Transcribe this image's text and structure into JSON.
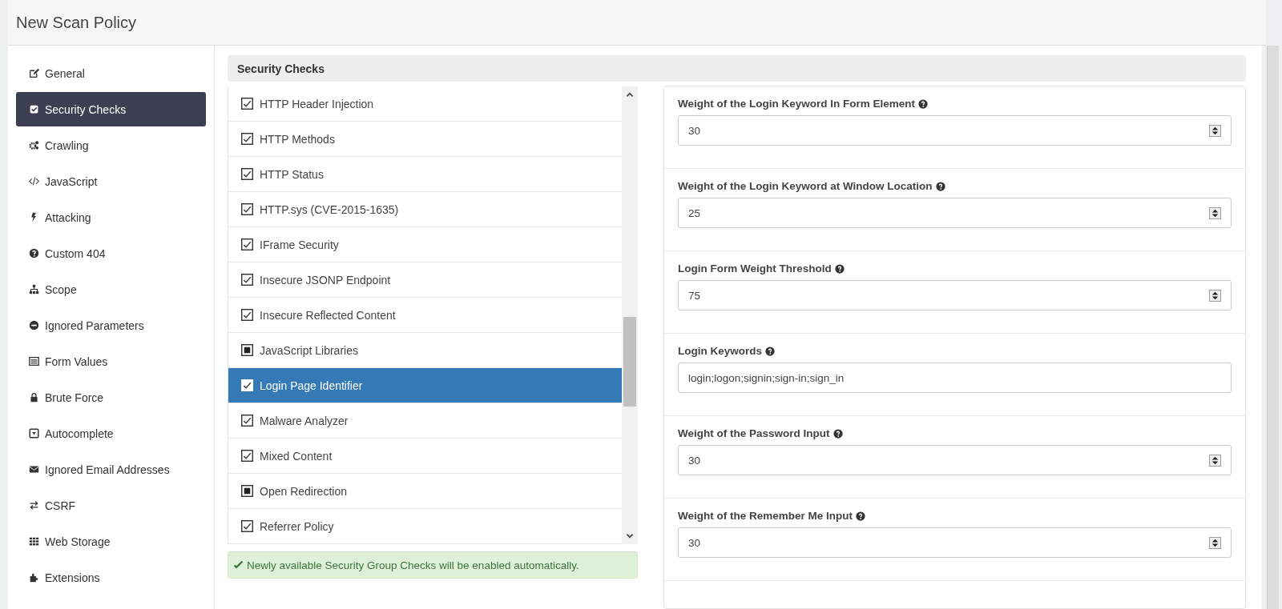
{
  "window": {
    "title": "New Scan Policy"
  },
  "sidebar": {
    "items": [
      {
        "label": "General",
        "selected": false
      },
      {
        "label": "Security Checks",
        "selected": true
      },
      {
        "label": "Crawling",
        "selected": false
      },
      {
        "label": "JavaScript",
        "selected": false
      },
      {
        "label": "Attacking",
        "selected": false
      },
      {
        "label": "Custom 404",
        "selected": false
      },
      {
        "label": "Scope",
        "selected": false
      },
      {
        "label": "Ignored Parameters",
        "selected": false
      },
      {
        "label": "Form Values",
        "selected": false
      },
      {
        "label": "Brute Force",
        "selected": false
      },
      {
        "label": "Autocomplete",
        "selected": false
      },
      {
        "label": "Ignored Email Addresses",
        "selected": false
      },
      {
        "label": "CSRF",
        "selected": false
      },
      {
        "label": "Web Storage",
        "selected": false
      },
      {
        "label": "Extensions",
        "selected": false
      }
    ]
  },
  "panel": {
    "title": "Security Checks"
  },
  "checks": [
    {
      "label": "HTTP Header Injection",
      "checked": true,
      "indeterminate": false,
      "selected": false
    },
    {
      "label": "HTTP Methods",
      "checked": true,
      "indeterminate": false,
      "selected": false
    },
    {
      "label": "HTTP Status",
      "checked": true,
      "indeterminate": false,
      "selected": false
    },
    {
      "label": "HTTP.sys (CVE-2015-1635)",
      "checked": true,
      "indeterminate": false,
      "selected": false
    },
    {
      "label": "IFrame Security",
      "checked": true,
      "indeterminate": false,
      "selected": false
    },
    {
      "label": "Insecure JSONP Endpoint",
      "checked": true,
      "indeterminate": false,
      "selected": false
    },
    {
      "label": "Insecure Reflected Content",
      "checked": true,
      "indeterminate": false,
      "selected": false
    },
    {
      "label": "JavaScript Libraries",
      "checked": false,
      "indeterminate": true,
      "selected": false
    },
    {
      "label": "Login Page Identifier",
      "checked": true,
      "indeterminate": false,
      "selected": true
    },
    {
      "label": "Malware Analyzer",
      "checked": true,
      "indeterminate": false,
      "selected": false
    },
    {
      "label": "Mixed Content",
      "checked": true,
      "indeterminate": false,
      "selected": false
    },
    {
      "label": "Open Redirection",
      "checked": false,
      "indeterminate": true,
      "selected": false
    },
    {
      "label": "Referrer Policy",
      "checked": true,
      "indeterminate": false,
      "selected": false
    }
  ],
  "notice": {
    "text": "Newly available Security Group Checks will be enabled automatically."
  },
  "settings": [
    {
      "label": "Weight of the Login Keyword In Form Element",
      "kind": "number",
      "value": "30"
    },
    {
      "label": "Weight of the Login Keyword at Window Location",
      "kind": "number",
      "value": "25"
    },
    {
      "label": "Login Form Weight Threshold",
      "kind": "number",
      "value": "75"
    },
    {
      "label": "Login Keywords",
      "kind": "text",
      "value": "login;logon;signin;sign-in;sign_in"
    },
    {
      "label": "Weight of the Password Input",
      "kind": "number",
      "value": "30"
    },
    {
      "label": "Weight of the Remember Me Input",
      "kind": "number",
      "value": "30"
    }
  ]
}
